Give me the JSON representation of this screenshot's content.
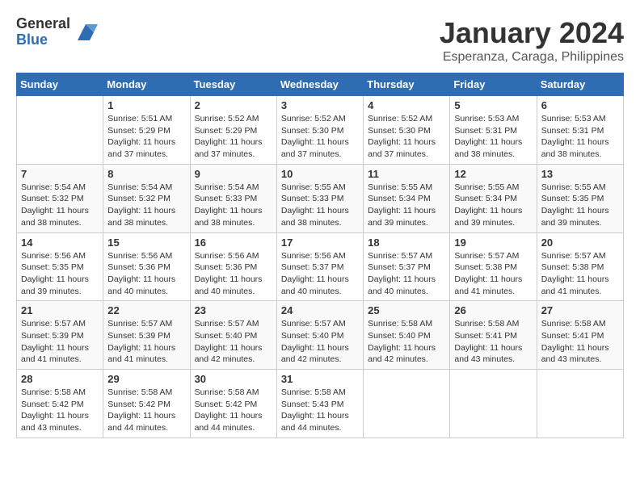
{
  "logo": {
    "general": "General",
    "blue": "Blue"
  },
  "title": "January 2024",
  "subtitle": "Esperanza, Caraga, Philippines",
  "weekdays": [
    "Sunday",
    "Monday",
    "Tuesday",
    "Wednesday",
    "Thursday",
    "Friday",
    "Saturday"
  ],
  "weeks": [
    [
      {
        "day": "",
        "sunrise": "",
        "sunset": "",
        "daylight": ""
      },
      {
        "day": "1",
        "sunrise": "Sunrise: 5:51 AM",
        "sunset": "Sunset: 5:29 PM",
        "daylight": "Daylight: 11 hours and 37 minutes."
      },
      {
        "day": "2",
        "sunrise": "Sunrise: 5:52 AM",
        "sunset": "Sunset: 5:29 PM",
        "daylight": "Daylight: 11 hours and 37 minutes."
      },
      {
        "day": "3",
        "sunrise": "Sunrise: 5:52 AM",
        "sunset": "Sunset: 5:30 PM",
        "daylight": "Daylight: 11 hours and 37 minutes."
      },
      {
        "day": "4",
        "sunrise": "Sunrise: 5:52 AM",
        "sunset": "Sunset: 5:30 PM",
        "daylight": "Daylight: 11 hours and 37 minutes."
      },
      {
        "day": "5",
        "sunrise": "Sunrise: 5:53 AM",
        "sunset": "Sunset: 5:31 PM",
        "daylight": "Daylight: 11 hours and 38 minutes."
      },
      {
        "day": "6",
        "sunrise": "Sunrise: 5:53 AM",
        "sunset": "Sunset: 5:31 PM",
        "daylight": "Daylight: 11 hours and 38 minutes."
      }
    ],
    [
      {
        "day": "7",
        "sunrise": "Sunrise: 5:54 AM",
        "sunset": "Sunset: 5:32 PM",
        "daylight": "Daylight: 11 hours and 38 minutes."
      },
      {
        "day": "8",
        "sunrise": "Sunrise: 5:54 AM",
        "sunset": "Sunset: 5:32 PM",
        "daylight": "Daylight: 11 hours and 38 minutes."
      },
      {
        "day": "9",
        "sunrise": "Sunrise: 5:54 AM",
        "sunset": "Sunset: 5:33 PM",
        "daylight": "Daylight: 11 hours and 38 minutes."
      },
      {
        "day": "10",
        "sunrise": "Sunrise: 5:55 AM",
        "sunset": "Sunset: 5:33 PM",
        "daylight": "Daylight: 11 hours and 38 minutes."
      },
      {
        "day": "11",
        "sunrise": "Sunrise: 5:55 AM",
        "sunset": "Sunset: 5:34 PM",
        "daylight": "Daylight: 11 hours and 39 minutes."
      },
      {
        "day": "12",
        "sunrise": "Sunrise: 5:55 AM",
        "sunset": "Sunset: 5:34 PM",
        "daylight": "Daylight: 11 hours and 39 minutes."
      },
      {
        "day": "13",
        "sunrise": "Sunrise: 5:55 AM",
        "sunset": "Sunset: 5:35 PM",
        "daylight": "Daylight: 11 hours and 39 minutes."
      }
    ],
    [
      {
        "day": "14",
        "sunrise": "Sunrise: 5:56 AM",
        "sunset": "Sunset: 5:35 PM",
        "daylight": "Daylight: 11 hours and 39 minutes."
      },
      {
        "day": "15",
        "sunrise": "Sunrise: 5:56 AM",
        "sunset": "Sunset: 5:36 PM",
        "daylight": "Daylight: 11 hours and 40 minutes."
      },
      {
        "day": "16",
        "sunrise": "Sunrise: 5:56 AM",
        "sunset": "Sunset: 5:36 PM",
        "daylight": "Daylight: 11 hours and 40 minutes."
      },
      {
        "day": "17",
        "sunrise": "Sunrise: 5:56 AM",
        "sunset": "Sunset: 5:37 PM",
        "daylight": "Daylight: 11 hours and 40 minutes."
      },
      {
        "day": "18",
        "sunrise": "Sunrise: 5:57 AM",
        "sunset": "Sunset: 5:37 PM",
        "daylight": "Daylight: 11 hours and 40 minutes."
      },
      {
        "day": "19",
        "sunrise": "Sunrise: 5:57 AM",
        "sunset": "Sunset: 5:38 PM",
        "daylight": "Daylight: 11 hours and 41 minutes."
      },
      {
        "day": "20",
        "sunrise": "Sunrise: 5:57 AM",
        "sunset": "Sunset: 5:38 PM",
        "daylight": "Daylight: 11 hours and 41 minutes."
      }
    ],
    [
      {
        "day": "21",
        "sunrise": "Sunrise: 5:57 AM",
        "sunset": "Sunset: 5:39 PM",
        "daylight": "Daylight: 11 hours and 41 minutes."
      },
      {
        "day": "22",
        "sunrise": "Sunrise: 5:57 AM",
        "sunset": "Sunset: 5:39 PM",
        "daylight": "Daylight: 11 hours and 41 minutes."
      },
      {
        "day": "23",
        "sunrise": "Sunrise: 5:57 AM",
        "sunset": "Sunset: 5:40 PM",
        "daylight": "Daylight: 11 hours and 42 minutes."
      },
      {
        "day": "24",
        "sunrise": "Sunrise: 5:57 AM",
        "sunset": "Sunset: 5:40 PM",
        "daylight": "Daylight: 11 hours and 42 minutes."
      },
      {
        "day": "25",
        "sunrise": "Sunrise: 5:58 AM",
        "sunset": "Sunset: 5:40 PM",
        "daylight": "Daylight: 11 hours and 42 minutes."
      },
      {
        "day": "26",
        "sunrise": "Sunrise: 5:58 AM",
        "sunset": "Sunset: 5:41 PM",
        "daylight": "Daylight: 11 hours and 43 minutes."
      },
      {
        "day": "27",
        "sunrise": "Sunrise: 5:58 AM",
        "sunset": "Sunset: 5:41 PM",
        "daylight": "Daylight: 11 hours and 43 minutes."
      }
    ],
    [
      {
        "day": "28",
        "sunrise": "Sunrise: 5:58 AM",
        "sunset": "Sunset: 5:42 PM",
        "daylight": "Daylight: 11 hours and 43 minutes."
      },
      {
        "day": "29",
        "sunrise": "Sunrise: 5:58 AM",
        "sunset": "Sunset: 5:42 PM",
        "daylight": "Daylight: 11 hours and 44 minutes."
      },
      {
        "day": "30",
        "sunrise": "Sunrise: 5:58 AM",
        "sunset": "Sunset: 5:42 PM",
        "daylight": "Daylight: 11 hours and 44 minutes."
      },
      {
        "day": "31",
        "sunrise": "Sunrise: 5:58 AM",
        "sunset": "Sunset: 5:43 PM",
        "daylight": "Daylight: 11 hours and 44 minutes."
      },
      {
        "day": "",
        "sunrise": "",
        "sunset": "",
        "daylight": ""
      },
      {
        "day": "",
        "sunrise": "",
        "sunset": "",
        "daylight": ""
      },
      {
        "day": "",
        "sunrise": "",
        "sunset": "",
        "daylight": ""
      }
    ]
  ]
}
